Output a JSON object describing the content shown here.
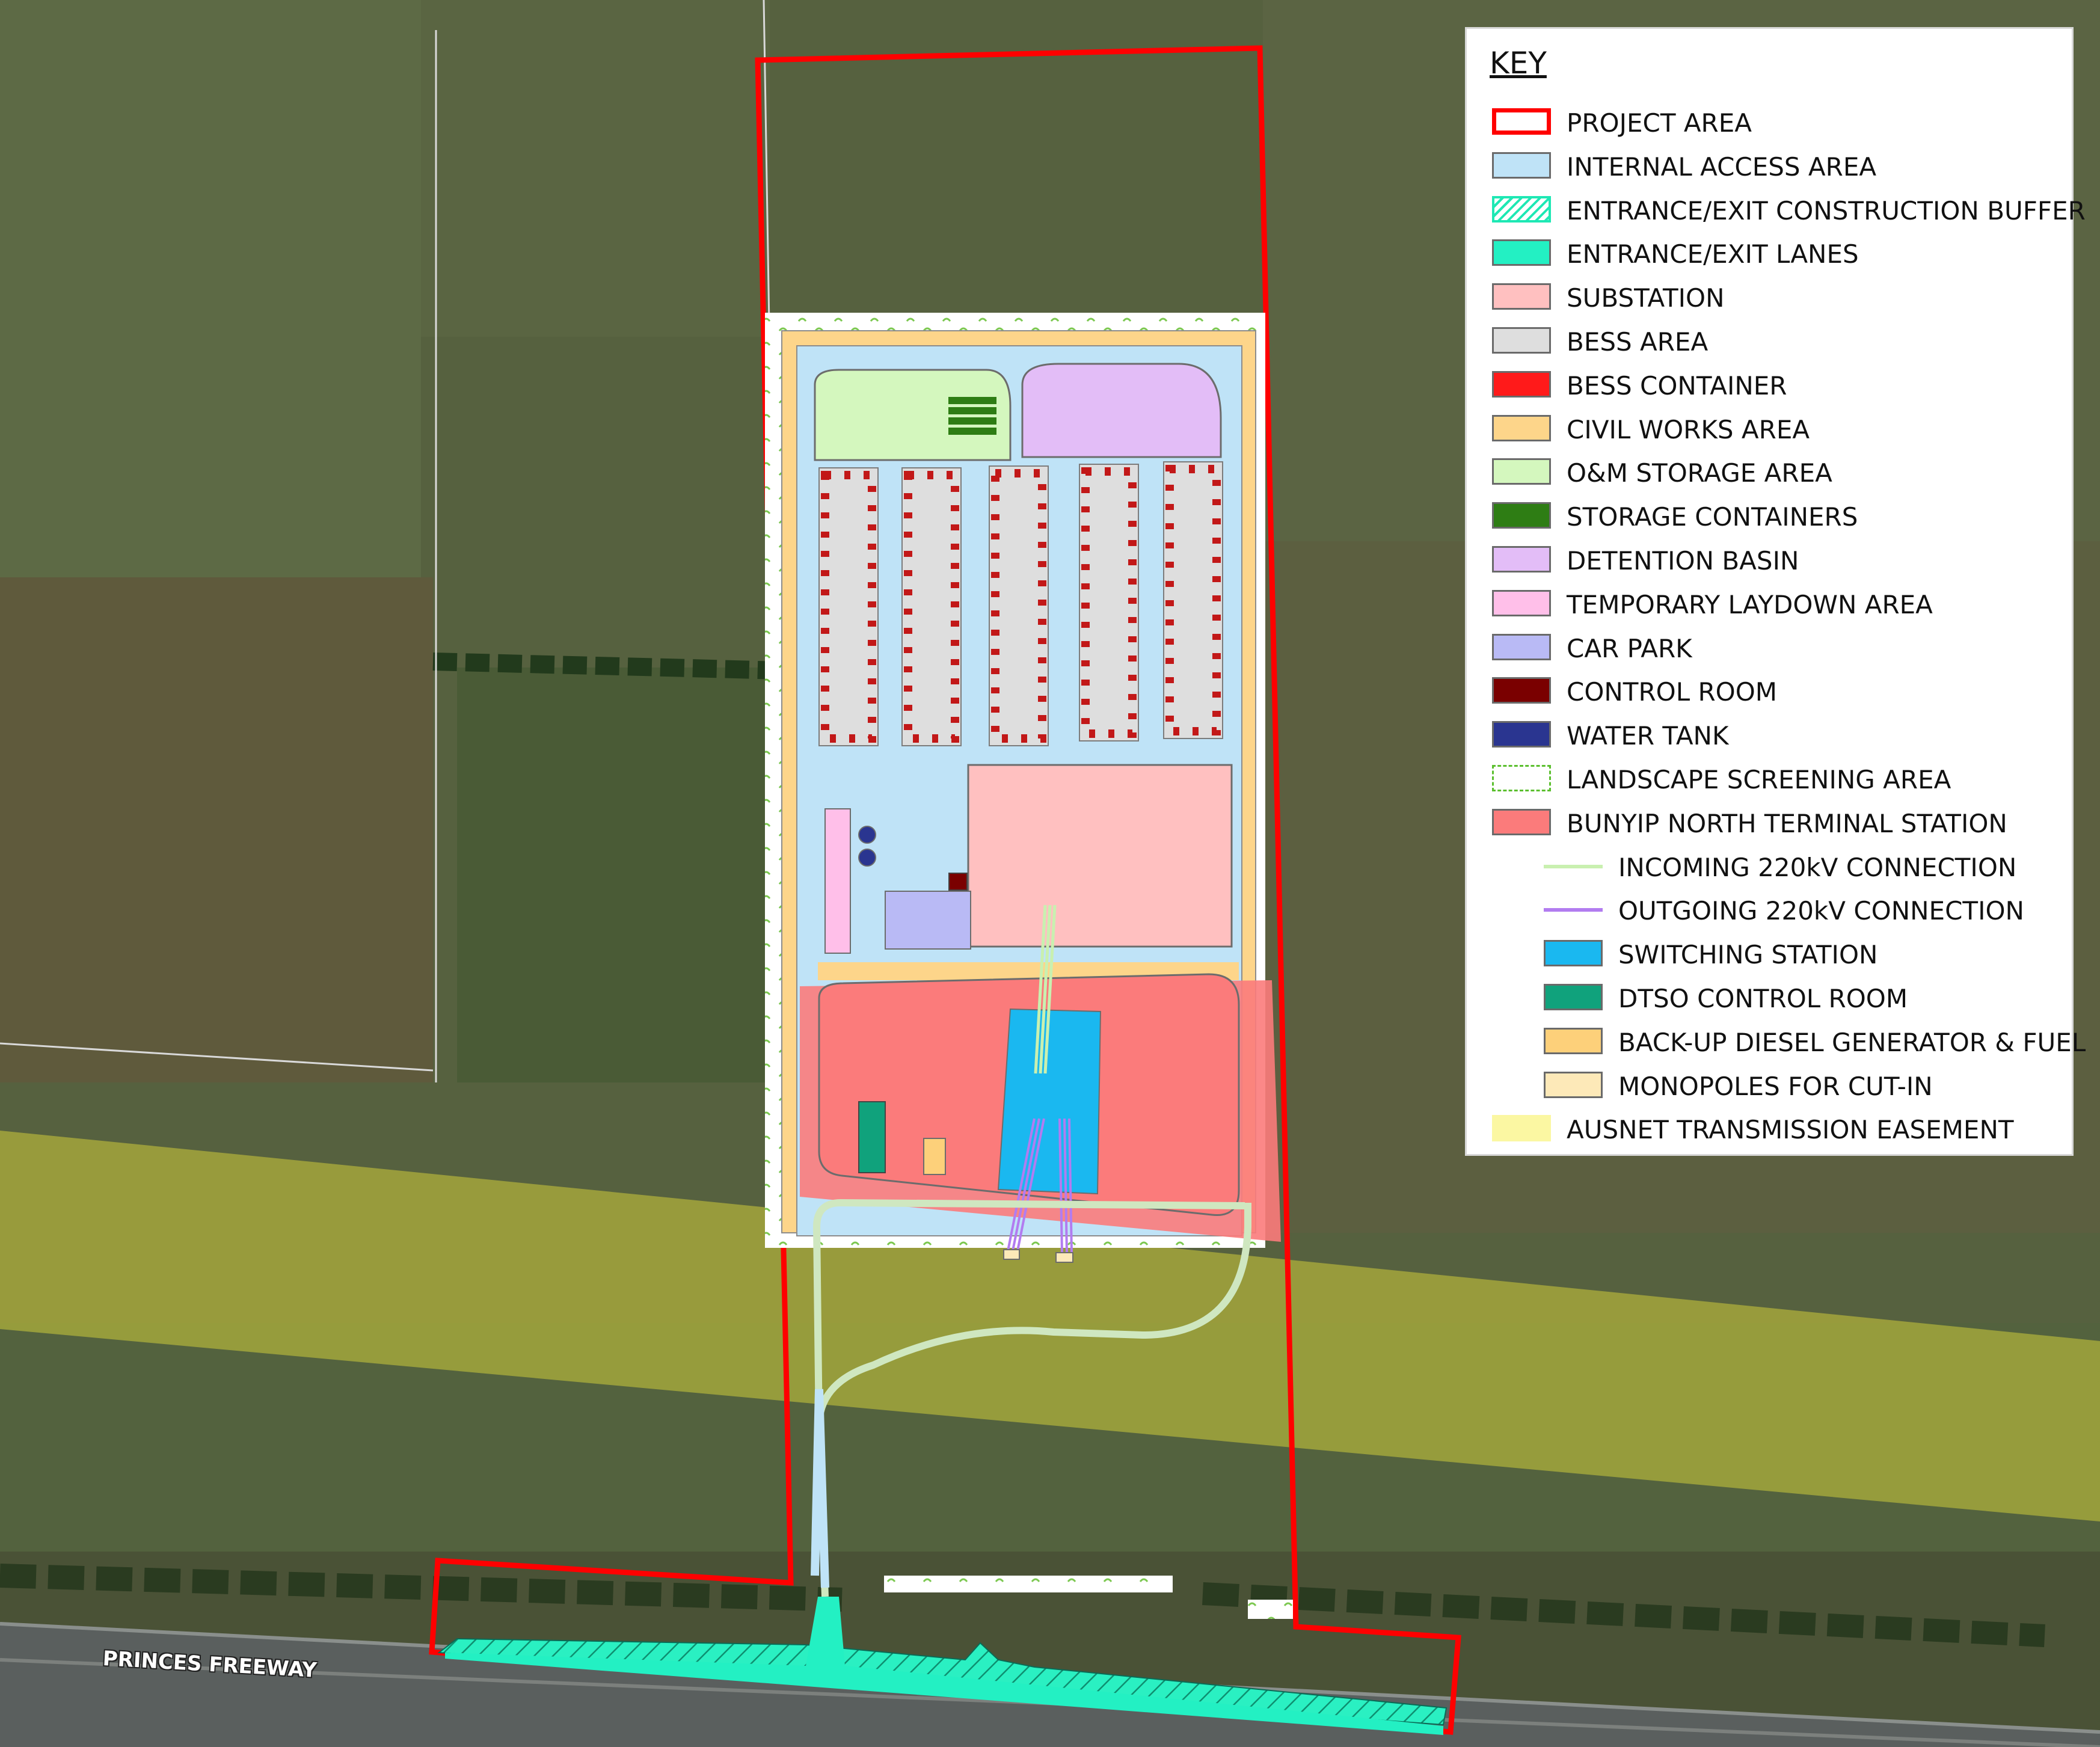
{
  "map": {
    "road_label": "PRINCES FREEWAY"
  },
  "legend": {
    "title": "KEY",
    "items": [
      {
        "label": "PROJECT AREA",
        "swatch": "outline",
        "color": "#ff0000",
        "icon": "project-area-swatch"
      },
      {
        "label": "INTERNAL ACCESS AREA",
        "swatch": "fill",
        "color": "#bfe3f7",
        "icon": "internal-access-swatch"
      },
      {
        "label": "ENTRANCE/EXIT CONSTRUCTION BUFFER",
        "swatch": "hatch",
        "color": "#1ee8b4",
        "icon": "construction-buffer-swatch"
      },
      {
        "label": "ENTRANCE/EXIT LANES",
        "swatch": "fill",
        "color": "#23f0c3",
        "icon": "entrance-lanes-swatch"
      },
      {
        "label": "SUBSTATION",
        "swatch": "fill",
        "color": "#ffc0c0",
        "icon": "substation-swatch"
      },
      {
        "label": "BESS AREA",
        "swatch": "fill",
        "color": "#dedede",
        "icon": "bess-area-swatch"
      },
      {
        "label": "BESS CONTAINER",
        "swatch": "fill",
        "color": "#ff1a1a",
        "icon": "bess-container-swatch"
      },
      {
        "label": "CIVIL WORKS AREA",
        "swatch": "fill",
        "color": "#fdd58a",
        "icon": "civil-works-swatch"
      },
      {
        "label": "O&M STORAGE AREA",
        "swatch": "fill",
        "color": "#d4f7be",
        "icon": "om-storage-swatch"
      },
      {
        "label": "STORAGE CONTAINERS",
        "swatch": "fill",
        "color": "#2e7d14",
        "icon": "storage-containers-swatch"
      },
      {
        "label": "DETENTION BASIN",
        "swatch": "fill",
        "color": "#e3bdf7",
        "icon": "detention-basin-swatch"
      },
      {
        "label": "TEMPORARY LAYDOWN AREA",
        "swatch": "fill",
        "color": "#ffbfe9",
        "icon": "laydown-area-swatch"
      },
      {
        "label": "CAR PARK",
        "swatch": "fill",
        "color": "#b9baf5",
        "icon": "car-park-swatch"
      },
      {
        "label": "CONTROL ROOM",
        "swatch": "fill",
        "color": "#7a0000",
        "icon": "control-room-swatch"
      },
      {
        "label": "WATER TANK",
        "swatch": "fill",
        "color": "#2a3590",
        "icon": "water-tank-swatch"
      },
      {
        "label": "LANDSCAPE SCREENING AREA",
        "swatch": "screen",
        "color": "#5bbf2e",
        "icon": "landscape-screening-swatch"
      },
      {
        "label": "BUNYIP NORTH TERMINAL STATION",
        "swatch": "fill",
        "color": "#fb7b7b",
        "icon": "terminal-station-swatch"
      },
      {
        "label": "INCOMING 220kV CONNECTION",
        "swatch": "line",
        "color": "#c9f0b0",
        "icon": "incoming-220kv-swatch",
        "indent": true
      },
      {
        "label": "OUTGOING 220kV CONNECTION",
        "swatch": "line",
        "color": "#b27cf0",
        "icon": "outgoing-220kv-swatch",
        "indent": true
      },
      {
        "label": "SWITCHING STATION",
        "swatch": "fill",
        "color": "#1ab8f0",
        "icon": "switching-station-swatch",
        "indent": true
      },
      {
        "label": "DTSO CONTROL ROOM",
        "swatch": "fill",
        "color": "#10a27c",
        "icon": "dtso-control-room-swatch",
        "indent": true
      },
      {
        "label": "BACK-UP DIESEL GENERATOR & FUEL",
        "swatch": "fill",
        "color": "#fdd07a",
        "icon": "diesel-generator-swatch",
        "indent": true
      },
      {
        "label": "MONOPOLES FOR CUT-IN",
        "swatch": "fill",
        "color": "#fde9b8",
        "icon": "monopoles-swatch",
        "indent": true
      },
      {
        "label": "AUSNET TRANSMISSION EASEMENT",
        "swatch": "fill-noborder",
        "color": "#fbf7a2",
        "icon": "easement-swatch"
      }
    ]
  }
}
